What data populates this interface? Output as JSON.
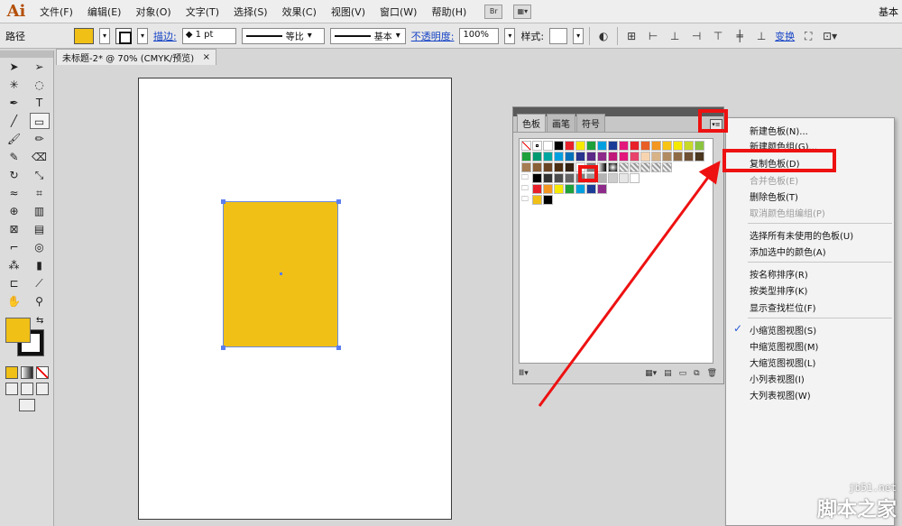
{
  "app": {
    "logo": "Ai",
    "workspace": "基本"
  },
  "menu": [
    "文件(F)",
    "编辑(E)",
    "对象(O)",
    "文字(T)",
    "选择(S)",
    "效果(C)",
    "视图(V)",
    "窗口(W)",
    "帮助(H)"
  ],
  "menubar_buttons": {
    "bridge": "Br"
  },
  "controlbar": {
    "selection_label": "路径",
    "stroke_link": "描边:",
    "stroke_weight": "1 pt",
    "profile_label": "等比",
    "brush_label": "基本",
    "opacity_link": "不透明度:",
    "opacity_value": "100%",
    "style_label": "样式:",
    "transform_link": "变换"
  },
  "document_tab": {
    "title": "未标题-2* @ 70% (CMYK/预览)",
    "close": "×"
  },
  "swatches_panel": {
    "tabs": [
      "色板",
      "画笔",
      "符号"
    ],
    "active_tab": "色板",
    "menu_icon": "▾≡",
    "rows": [
      [
        "none",
        "registration",
        "#ffffff",
        "#000000",
        "#e8202a",
        "#f5e900",
        "#1ea13b",
        "#00a0e0",
        "#1b3c96",
        "#e3187c",
        "#e8202a",
        "#e85e24",
        "#f39622",
        "#f7c415",
        "#f5e900",
        "#c9d928",
        "#8bc53f"
      ],
      [
        "#1ea13b",
        "#009a70",
        "#00a7a0",
        "#00a0e0",
        "#0072bb",
        "#27358f",
        "#5b2a86",
        "#8e2a89",
        "#c0197a",
        "#e3187c",
        "#e8436b",
        "#f7d4b0",
        "#d8b388",
        "#b18b61",
        "#8e6b46",
        "#6f5034",
        "#4b3620"
      ],
      [
        "#a67c52",
        "#8a6038",
        "#6b4424",
        "#4e2e12",
        "#332010",
        "#ffffff",
        "#7f7f7f",
        "gradient-1",
        "gradient-2",
        "pattern-1",
        "pattern-2",
        "pattern-3",
        "pattern-4",
        "pattern-5"
      ],
      [
        "folder",
        "#000000",
        "#333333",
        "#4d4d4d",
        "#666666",
        "#808080",
        "#999999",
        "#b3b3b3",
        "#cccccc",
        "#e6e6e6",
        "#ffffff"
      ],
      [
        "folder",
        "#e8202a",
        "#f39622",
        "#f5e900",
        "#1ea13b",
        "#00a0e0",
        "#1b3c96",
        "#8e2a89"
      ],
      [
        "folder",
        "#f0c016",
        "#000000"
      ]
    ],
    "footer": [
      "库",
      "菜单",
      "类型",
      "新建",
      "组",
      "删除"
    ]
  },
  "flyout_menu": {
    "items": [
      {
        "label": "新建色板(N)...",
        "enabled": true
      },
      {
        "label": "新建颜色组(G)...",
        "enabled": true
      },
      {
        "label": "复制色板(D)",
        "enabled": true
      },
      {
        "label": "合并色板(E)",
        "enabled": false
      },
      {
        "label": "删除色板(T)",
        "enabled": true
      },
      {
        "label": "取消颜色组编组(P)",
        "enabled": false
      },
      {
        "label": "选择所有未使用的色板(U)",
        "enabled": true
      },
      {
        "label": "添加选中的颜色(A)",
        "enabled": true
      },
      {
        "label": "按名称排序(R)",
        "enabled": true
      },
      {
        "label": "按类型排序(K)",
        "enabled": true
      },
      {
        "label": "显示查找栏位(F)",
        "enabled": true
      },
      {
        "label": "小缩览图视图(S)",
        "enabled": true,
        "checked": true
      },
      {
        "label": "中缩览图视图(M)",
        "enabled": true
      },
      {
        "label": "大缩览图视图(L)",
        "enabled": true
      },
      {
        "label": "小列表视图(I)",
        "enabled": true
      },
      {
        "label": "大列表视图(W)",
        "enabled": true
      }
    ],
    "check": "✓"
  },
  "colors": {
    "fill": "#f0c016",
    "highlight": "#ee1111",
    "selection": "#5b7ef0"
  },
  "watermark": {
    "site": "jb51.net",
    "name": "脚本之家"
  }
}
